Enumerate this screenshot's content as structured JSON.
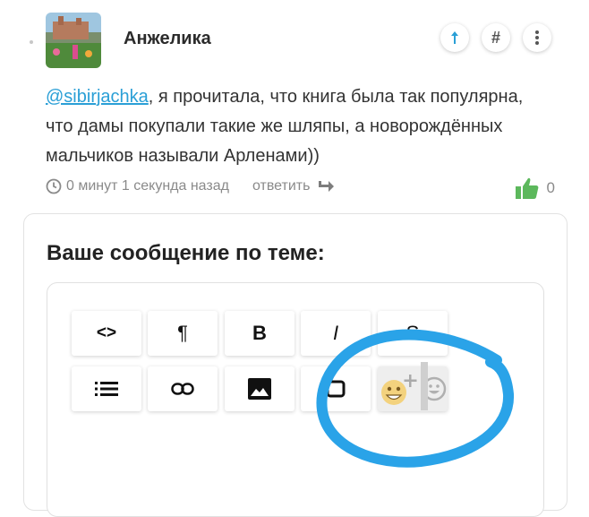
{
  "post": {
    "author": "Анжелика",
    "mention": "@sibirjachka",
    "text": ", я прочитала, что книга была так популярна, что дамы покупали такие же шляпы, а новорождённых мальчиков называли Арленами))",
    "time": "0 минут 1 секунда назад",
    "reply_label": "ответить",
    "likes": "0",
    "actions": {
      "share": "share-icon",
      "hashtag": "#",
      "more": "more-vertical-icon"
    }
  },
  "composer": {
    "title": "Ваше сообщение по теме:",
    "toolbar_row1": [
      "<>",
      "¶",
      "B",
      "I",
      "S"
    ],
    "toolbar_row2_icons": [
      "list-icon",
      "link-icon",
      "image-icon",
      "embed-icon",
      "emoji-add-icon",
      "emoji-icon"
    ]
  },
  "colors": {
    "link": "#2a9fd6",
    "like": "#5cb85c",
    "annotation": "#2aa3e8"
  }
}
